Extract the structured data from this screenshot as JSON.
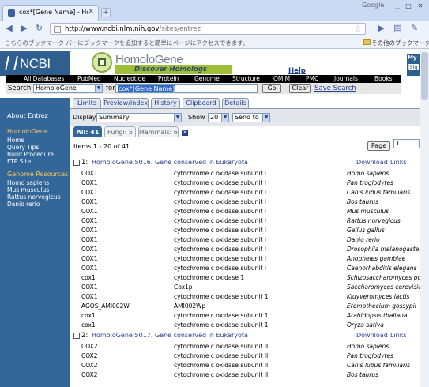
{
  "browser": {
    "tab_title": "cox*[Gene Name] - Homol…",
    "brand": "Google",
    "url_host": "http://www.ncbi.nlm.nih.gov",
    "url_path": "/sites/entrez",
    "bookmark_msg": "こちらのブックマーク バーにブックマークを追加すると簡単にページにアクセスできます。",
    "other_bookmarks": "その他のブックマーク"
  },
  "header": {
    "ncbi_logo": "NCBI",
    "homologene_title": "HomoloGene",
    "homologene_sub": "Discover Homologs",
    "help": "Help",
    "my": "My",
    "my_sub": "[Sig"
  },
  "db_bar": [
    "All Databases",
    "PubMed",
    "Nucleotide",
    "Protein",
    "Genome",
    "Structure",
    "OMIM",
    "PMC",
    "Journals",
    "Books"
  ],
  "search": {
    "label": "Search",
    "database": "HomoloGene",
    "for_label": "for",
    "query": "cox*[Gene Name]",
    "go": "Go",
    "clear": "Clear",
    "save_search": "Save Search"
  },
  "sidebar": {
    "about": "About Entrez",
    "homologene_head": "HomoloGene",
    "links": [
      "Home",
      "Query Tips",
      "Build Procedure",
      "FTP Site"
    ],
    "genome_head": "Genome Resources",
    "genomes": [
      "Homo sapiens",
      "Mus musculus",
      "Rattus norvegicus",
      "Danio rerio"
    ]
  },
  "tabs": [
    "Limits",
    "Preview/Index",
    "History",
    "Clipboard",
    "Details"
  ],
  "display": {
    "display_label": "Display",
    "display_value": "Summary",
    "show_label": "Show",
    "show_value": "20",
    "send_to": "Send to"
  },
  "filters": [
    {
      "label": "All: 41"
    },
    {
      "label": "Fungi: 5"
    },
    {
      "label": "Mammals: 6"
    }
  ],
  "filter_close": "✕",
  "results": {
    "items_text": "Items 1 - 20 of 41",
    "page_button": "Page",
    "page_value": "1",
    "groups": [
      {
        "num": "1:",
        "title": "HomoloGene:5016. Gene conserved in Eukaryota",
        "download": "Download",
        "links": "Links",
        "rows": [
          {
            "gene": "COX1",
            "desc": "cytochrome c oxidase subunit I",
            "species": "Homo sapiens"
          },
          {
            "gene": "COX1",
            "desc": "cytochrome c oxidase subunit I",
            "species": "Pan troglodytes"
          },
          {
            "gene": "COX1",
            "desc": "cytochrome c oxidase subunit I",
            "species": "Canis lupus familiaris"
          },
          {
            "gene": "COX1",
            "desc": "cytochrome c oxidase subunit I",
            "species": "Bos taurus"
          },
          {
            "gene": "COX1",
            "desc": "cytochrome c oxidase subunit I",
            "species": "Mus musculus"
          },
          {
            "gene": "COX1",
            "desc": "cytochrome c oxidase subunit I",
            "species": "Rattus norvegicus"
          },
          {
            "gene": "COX1",
            "desc": "cytochrome c oxidase subunit I",
            "species": "Gallus gallus"
          },
          {
            "gene": "COX1",
            "desc": "cytochrome c oxidase subunit I",
            "species": "Danio rerio"
          },
          {
            "gene": "COX1",
            "desc": "cytochrome c oxidase subunit I",
            "species": "Drosophila melanogaster"
          },
          {
            "gene": "COX1",
            "desc": "cytochrome c oxidase subunit I",
            "species": "Anopheles gambiae"
          },
          {
            "gene": "COX1",
            "desc": "cytochrome c oxidase subunit I",
            "species": "Caenorhabditis elegans"
          },
          {
            "gene": "cox1",
            "desc": "cytochrome c oxidase 1",
            "species": "Schizosaccharomyces por"
          },
          {
            "gene": "COX1",
            "desc": "Cox1p",
            "species": "Saccharomyces cerevisia"
          },
          {
            "gene": "COX1",
            "desc": "cytochrome c oxidase subunit 1",
            "species": "Kluyveromyces lactis"
          },
          {
            "gene": "AGOS_AMI002W",
            "desc": "AMI002Wp",
            "species": "Eremothecium gossypii"
          },
          {
            "gene": "cox1",
            "desc": "cytochrome c oxidase subunit 1",
            "species": "Arabidopsis thaliana"
          },
          {
            "gene": "cox1",
            "desc": "cytochrome c oxidase subunit 1",
            "species": "Oryza sativa"
          }
        ]
      },
      {
        "num": "2:",
        "title": "HomoloGene:5017. Gene conserved in Eukaryota",
        "download": "Download",
        "links": "Links",
        "rows": [
          {
            "gene": "COX2",
            "desc": "cytochrome c oxidase subunit II",
            "species": "Homo sapiens"
          },
          {
            "gene": "COX2",
            "desc": "cytochrome c oxidase subunit II",
            "species": "Pan troglodytes"
          },
          {
            "gene": "COX2",
            "desc": "cytochrome c oxidase subunit II",
            "species": "Canis lupus familiaris"
          },
          {
            "gene": "COX2",
            "desc": "cytochrome c oxidase subunit II",
            "species": "Bos taurus"
          }
        ]
      }
    ]
  },
  "colors": {
    "ncbi_blue": "#336699",
    "link_blue": "#24408f",
    "sidebar_heading": "#f9c85a",
    "homologene_green": "#9fbf3a"
  }
}
